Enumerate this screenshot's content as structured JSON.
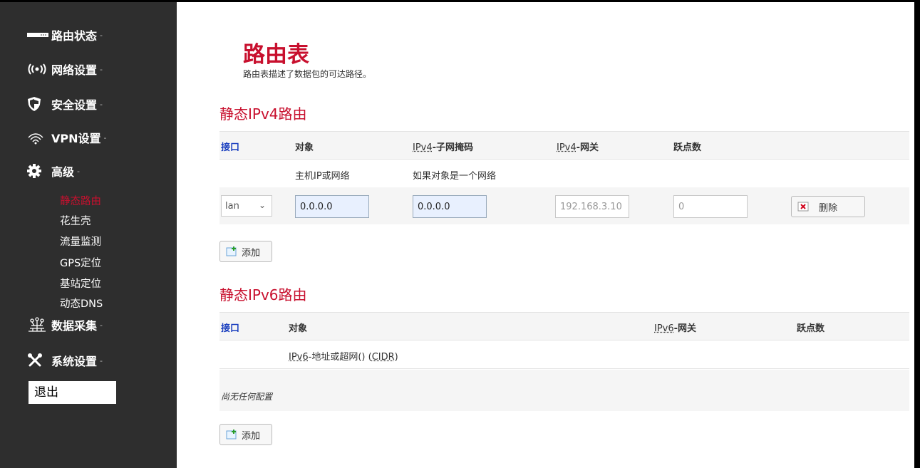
{
  "sidebar": {
    "menu": [
      {
        "label": "路由状态",
        "icon": "status-bar-icon"
      },
      {
        "label": "网络设置",
        "icon": "wireless-signal-icon"
      },
      {
        "label": "安全设置",
        "icon": "shield-icon"
      },
      {
        "label": "VPN设置",
        "icon": "wifi-icon"
      },
      {
        "label": "高级",
        "icon": "gear-icon"
      },
      {
        "label": "数据采集",
        "icon": "data-collect-icon"
      },
      {
        "label": "系统设置",
        "icon": "tools-icon"
      }
    ],
    "caret": "-",
    "submenu": [
      "静态路由",
      "花生壳",
      "流量监测",
      "GPS定位",
      "基站定位",
      "动态DNS"
    ],
    "logout": "退出"
  },
  "page": {
    "title": "路由表",
    "description": "路由表描述了数据包的可达路径。"
  },
  "ipv4": {
    "title": "静态IPv4路由",
    "headers": {
      "iface": "接口",
      "target": "对象",
      "netmask_abbr": "IPv4",
      "netmask_rest": "-子网掩码",
      "gateway_abbr": "IPv4",
      "gateway_rest": "-网关",
      "metric": "跃点数"
    },
    "desc": {
      "target": "主机IP或网络",
      "netmask": "如果对象是一个网络"
    },
    "row": {
      "iface": "lan",
      "target": "0.0.0.0",
      "netmask": "0.0.0.0",
      "gateway_placeholder": "192.168.3.10",
      "metric_placeholder": "0",
      "delete": "删除"
    },
    "add": "添加"
  },
  "ipv6": {
    "title": "静态IPv6路由",
    "headers": {
      "iface": "接口",
      "target": "对象",
      "gateway_abbr": "IPv6",
      "gateway_rest": "-网关",
      "metric": "跃点数"
    },
    "desc": {
      "target_abbr": "IPv6",
      "target_mid": "-地址或超网() (",
      "target_cidr": "CIDR",
      "target_end": ")"
    },
    "empty": "尚无任何配置",
    "add": "添加"
  },
  "colors": {
    "accent": "#c8102e",
    "sidebar": "#2e2e2e",
    "header_link": "#1a3fbf"
  }
}
